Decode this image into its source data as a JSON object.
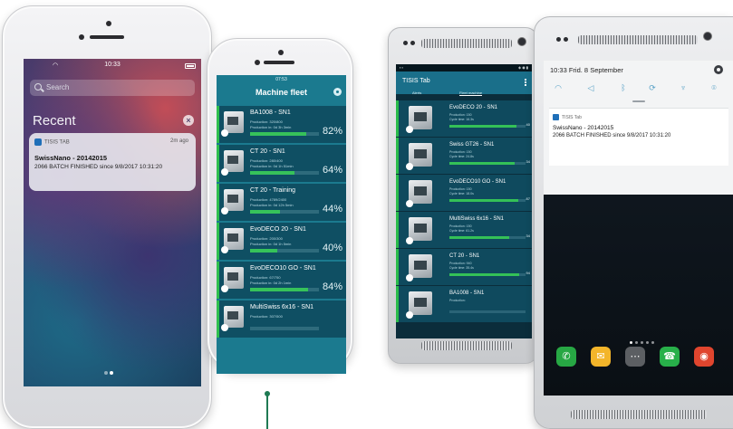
{
  "phone_lockscreen": {
    "time": "10:33",
    "search_placeholder": "Search",
    "recent_title": "Recent",
    "clear_icon": "close-circle-icon",
    "notification": {
      "app": "TISIS TAB",
      "time_ago": "2m ago",
      "title": "SwissNano - 20142015",
      "body": "2066 BATCH FINISHED since 9/8/2017 10:31:20"
    }
  },
  "phone_fleet": {
    "time": "07:53",
    "header_title": "Machine fleet",
    "accent_green": "#36c25a",
    "cards": [
      {
        "name": "BA1008 - SN1",
        "line1": "Production:      320/800",
        "line2": "Production in:   0d 3h 3min",
        "percent_label": "82%",
        "percent": 82
      },
      {
        "name": "CT 20 - SN1",
        "line1": "Production:      280/400",
        "line2": "Production in:   0d 1h 51min",
        "percent_label": "64%",
        "percent": 64
      },
      {
        "name": "CT 20 - Training",
        "line1": "Production:      4789/2400",
        "line2": "Production in:   0d 12h 5min",
        "percent_label": "44%",
        "percent": 44
      },
      {
        "name": "EvoDECO 20 - SN1",
        "line1": "Production:      200/300",
        "line2": "Production in:   0d 1h 5min",
        "percent_label": "40%",
        "percent": 40
      },
      {
        "name": "EvoDECO10 GO - SN1",
        "line1": "Production:      67/750",
        "line2": "Production in:   0d 2h 1min",
        "percent_label": "84%",
        "percent": 84
      },
      {
        "name": "MultiSwiss 6x16 - SN1",
        "line1": "Production:      307/500",
        "line2": "",
        "percent_label": "",
        "percent": 0
      }
    ]
  },
  "phone_tisis": {
    "app_title": "TISIS Tab",
    "tabs": [
      "Alerts",
      "Fleet machine"
    ],
    "cards": [
      {
        "name": "EvoDECO 20 - SN1",
        "line1": "Production:    150",
        "line2": "Cycle time:    16.3s",
        "percent_label": "40",
        "percent": 88
      },
      {
        "name": "Swiss GT26 - SN1",
        "line1": "Production:    150",
        "line2": "Cycle time:    24.8s",
        "percent_label": "34",
        "percent": 86
      },
      {
        "name": "EvoDECO10 GO - SN1",
        "line1": "Production:    150",
        "line2": "Cycle time:    18.0s",
        "percent_label": "87",
        "percent": 90
      },
      {
        "name": "MultiSwiss 6x16 - SN1",
        "line1": "Production:    150",
        "line2": "Cycle time:    61.2s",
        "percent_label": "34",
        "percent": 78
      },
      {
        "name": "CT 20 - SN1",
        "line1": "Production:    940",
        "line2": "Cycle time:    35.4s",
        "percent_label": "94",
        "percent": 92
      },
      {
        "name": "BA1008 - SN1",
        "line1": "Production:    ",
        "line2": "",
        "percent_label": "",
        "percent": 0
      }
    ]
  },
  "phone_android": {
    "shade_time": "10:33 Frid. 8 September",
    "quick_settings": [
      "wifi-icon",
      "mute-icon",
      "bluetooth-icon",
      "sync-icon",
      "flashlight-icon",
      "location-icon"
    ],
    "notification": {
      "app": "TISIS Tab",
      "title": "SwissNano - 20142015",
      "body": "2066 BATCH FINISHED since 9/8/2017 10:31:20"
    },
    "dock": [
      {
        "icon": "phone-icon",
        "color": "#27a744",
        "glyph": "✆"
      },
      {
        "icon": "messages-icon",
        "color": "#f3b52a",
        "glyph": "✉"
      },
      {
        "icon": "apps-icon",
        "color": "#5c5f63",
        "glyph": "⋯"
      },
      {
        "icon": "whatsapp-icon",
        "color": "#28b04a",
        "glyph": "☎"
      },
      {
        "icon": "chrome-icon",
        "color": "#e0452e",
        "glyph": "◉"
      }
    ]
  }
}
